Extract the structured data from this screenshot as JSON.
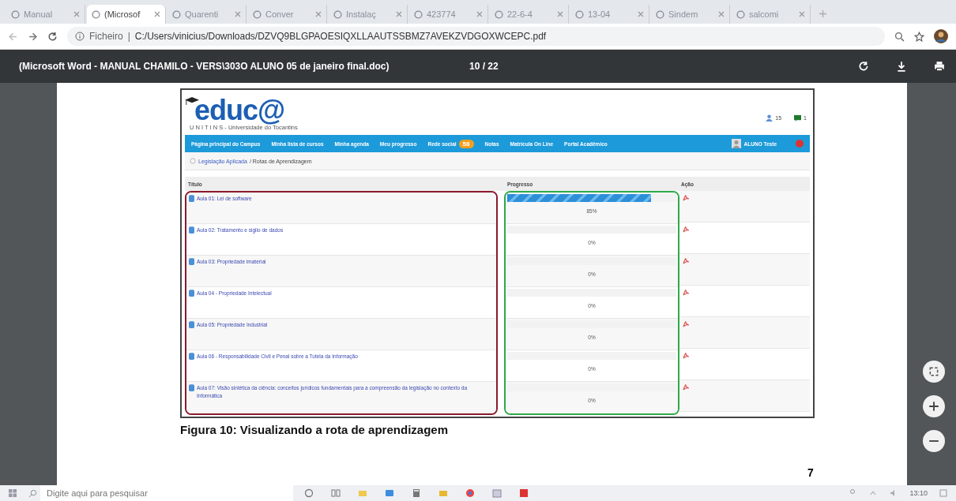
{
  "browser": {
    "tabs": [
      {
        "label": "Manual",
        "selected": false
      },
      {
        "label": "(Microsof",
        "selected": true
      },
      {
        "label": "Quarenti",
        "selected": false
      },
      {
        "label": "Conver",
        "selected": false
      },
      {
        "label": "Instalaç",
        "selected": false
      },
      {
        "label": "423774",
        "selected": false
      },
      {
        "label": "22-6-4",
        "selected": false
      },
      {
        "label": "13-04",
        "selected": false
      },
      {
        "label": "Sindem",
        "selected": false
      },
      {
        "label": "salcomi",
        "selected": false
      }
    ],
    "address": {
      "prefix": "Ficheiro",
      "separator": "|",
      "url": "C:/Users/vinicius/Downloads/DZVQ9BLGPAOESIQXLLAAUTSSBMZ7AVEKZVDGOXWCEPC.pdf"
    }
  },
  "pdf_toolbar": {
    "title": "(Microsoft Word - MANUAL CHAMILO - VERS\\303O ALUNO 05 de janeiro final.doc)",
    "page": "10 / 22"
  },
  "page": {
    "figure": {
      "logo": "educ@",
      "logo_subtitle": "U N I T I N S - Universidade do Tocantins",
      "header_counts": [
        {
          "kind": "users",
          "count": "15"
        },
        {
          "kind": "messages",
          "count": "1"
        }
      ],
      "nav": [
        {
          "label": "Página principal do Campus"
        },
        {
          "label": "Minha lista de cursos"
        },
        {
          "label": "Minha agenda"
        },
        {
          "label": "Meu progresso"
        },
        {
          "label": "Rede social",
          "badge": "58"
        },
        {
          "label": "Notas"
        },
        {
          "label": "Matrícula On Line"
        },
        {
          "label": "Portal Acadêmico"
        }
      ],
      "user": "ALUNO Teste",
      "breadcrumb": {
        "link": "Legislação Aplicada",
        "current": "/ Rotas de Aprendizagem"
      },
      "columns": [
        "Título",
        "Progresso",
        "Ação"
      ],
      "rows": [
        {
          "title": "Aula 01: Lei de software",
          "level": 0.85,
          "reading": "85%"
        },
        {
          "title": "Aula 02: Tratamento e sigilo de dados",
          "reading": "0%"
        },
        {
          "title": "Aula 03: Propriedade imaterial",
          "reading": "0%"
        },
        {
          "title": "Aula 04 - Propriedade Intelectual",
          "reading": "0%"
        },
        {
          "title": "Aula 05: Propriedade Industrial",
          "reading": "0%"
        },
        {
          "title": "Aula 06 - Responsabilidade Civil e Penal sobre a Tutela da Informação",
          "reading": "0%"
        },
        {
          "title": "Aula 07: Visão sintética da ciência: conceitos jurídicos fundamentais para a compreensão da legislação no contexto da Informática",
          "reading": "0%"
        }
      ]
    },
    "caption": "Figura 10: Visualizando a rota de aprendizagem",
    "page_number": "7"
  },
  "taskbar": {
    "search_placeholder": "Digite aqui para pesquisar",
    "time": "13:10"
  }
}
